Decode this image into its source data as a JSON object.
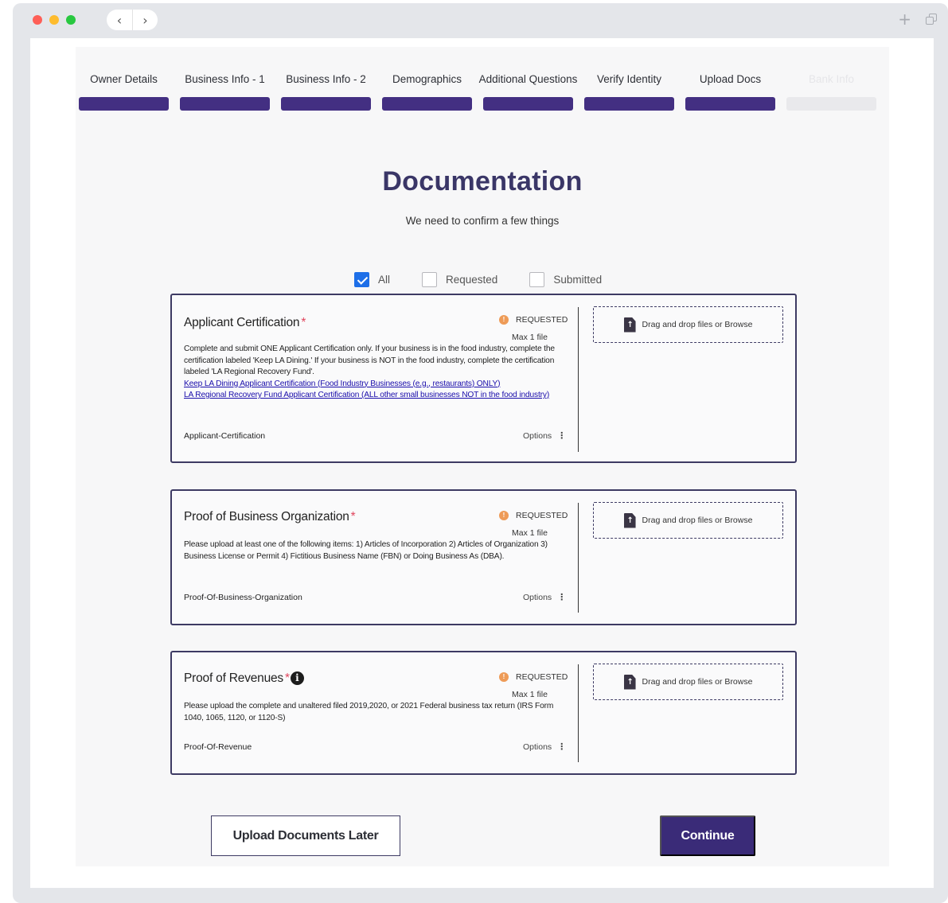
{
  "browser": {
    "back_glyph": "‹",
    "forward_glyph": "›",
    "new_tab_glyph": "+"
  },
  "steps": [
    {
      "label": "Owner Details",
      "state": "complete"
    },
    {
      "label": "Business Info - 1",
      "state": "complete"
    },
    {
      "label": "Business Info - 2",
      "state": "complete"
    },
    {
      "label": "Demographics",
      "state": "complete"
    },
    {
      "label": "Additional Questions",
      "state": "complete"
    },
    {
      "label": "Verify Identity",
      "state": "complete"
    },
    {
      "label": "Upload Docs",
      "state": "complete"
    },
    {
      "label": "Bank Info",
      "state": "pending"
    }
  ],
  "header": {
    "title": "Documentation",
    "subtitle": "We need to confirm a few things"
  },
  "filters": [
    {
      "label": "All",
      "checked": true
    },
    {
      "label": "Requested",
      "checked": false
    },
    {
      "label": "Submitted",
      "checked": false
    }
  ],
  "documents": [
    {
      "title": "Applicant Certification",
      "required_mark": "*",
      "status": "REQUESTED",
      "max_files": "Max 1 file",
      "description": "Complete and submit ONE Applicant Certification only. If your business is in the food industry, complete the certification labeled 'Keep LA Dining.' If your business is NOT in the food industry, complete the certification labeled 'LA Regional Recovery Fund'.",
      "links": [
        "Keep LA Dining Applicant Certification (Food Industry Businesses (e.g., restaurants) ONLY)",
        "LA Regional Recovery Fund Applicant Certification (ALL other small businesses NOT in the food industry)"
      ],
      "filename": "Applicant-Certification",
      "options_label": "Options",
      "dropzone_label": "Drag and drop files or Browse"
    },
    {
      "title": "Proof of Business Organization",
      "required_mark": "*",
      "status": "REQUESTED",
      "max_files": "Max 1 file",
      "description": "Please upload at least one of the following items: 1) Articles of Incorporation 2) Articles of Organization 3) Business License or Permit 4) Fictitious Business Name (FBN) or Doing Business As (DBA).",
      "links": [],
      "filename": "Proof-Of-Business-Organization",
      "options_label": "Options",
      "dropzone_label": "Drag and drop files or Browse"
    },
    {
      "title": "Proof of Revenues",
      "required_mark": "*",
      "info_glyph": "i",
      "status": "REQUESTED",
      "max_files": "Max 1 file",
      "description": "Please upload the complete and unaltered filed 2019,2020, or 2021 Federal business tax return (IRS Form 1040, 1065, 1120, or 1120-S)",
      "links": [],
      "filename": "Proof-Of-Revenue",
      "options_label": "Options",
      "dropzone_label": "Drag and drop files or Browse"
    }
  ],
  "actions": {
    "later_label": "Upload Documents Later",
    "continue_label": "Continue"
  },
  "colors": {
    "accent": "#432f82",
    "status_requested": "#ee9b57",
    "required": "#e0455d",
    "checkbox": "#1e6fe8"
  }
}
